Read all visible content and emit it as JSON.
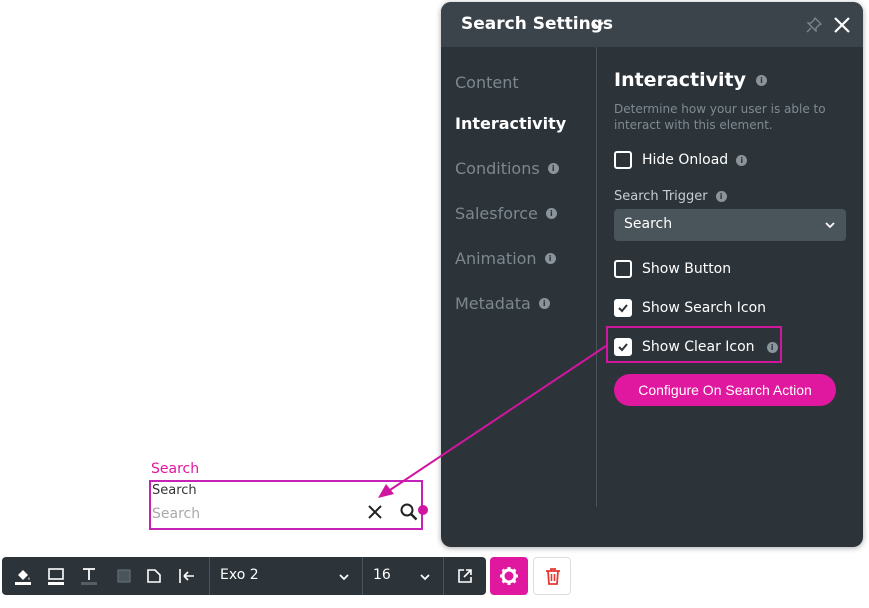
{
  "canvas": {
    "element_label": "Search",
    "inner_label": "Search",
    "placeholder": "Search"
  },
  "panel": {
    "title": "Search Settings",
    "nav": [
      {
        "label": "Content",
        "info": false
      },
      {
        "label": "Interactivity",
        "info": false,
        "active": true
      },
      {
        "label": "Conditions",
        "info": true
      },
      {
        "label": "Salesforce",
        "info": true
      },
      {
        "label": "Animation",
        "info": true
      },
      {
        "label": "Metadata",
        "info": true
      }
    ],
    "section_title": "Interactivity",
    "section_desc": "Determine how your user is able to interact with this element.",
    "hide_onload": "Hide Onload",
    "search_trigger_label": "Search Trigger",
    "search_trigger_value": "Search",
    "show_button": "Show Button",
    "show_search_icon": "Show Search Icon",
    "show_clear_icon": "Show Clear Icon",
    "configure_button": "Configure On Search Action"
  },
  "toolbar": {
    "font_family": "Exo 2",
    "font_size": "16"
  },
  "colors": {
    "accent": "#e0179f",
    "panel_bg": "#2c343a",
    "danger": "#e53935"
  }
}
